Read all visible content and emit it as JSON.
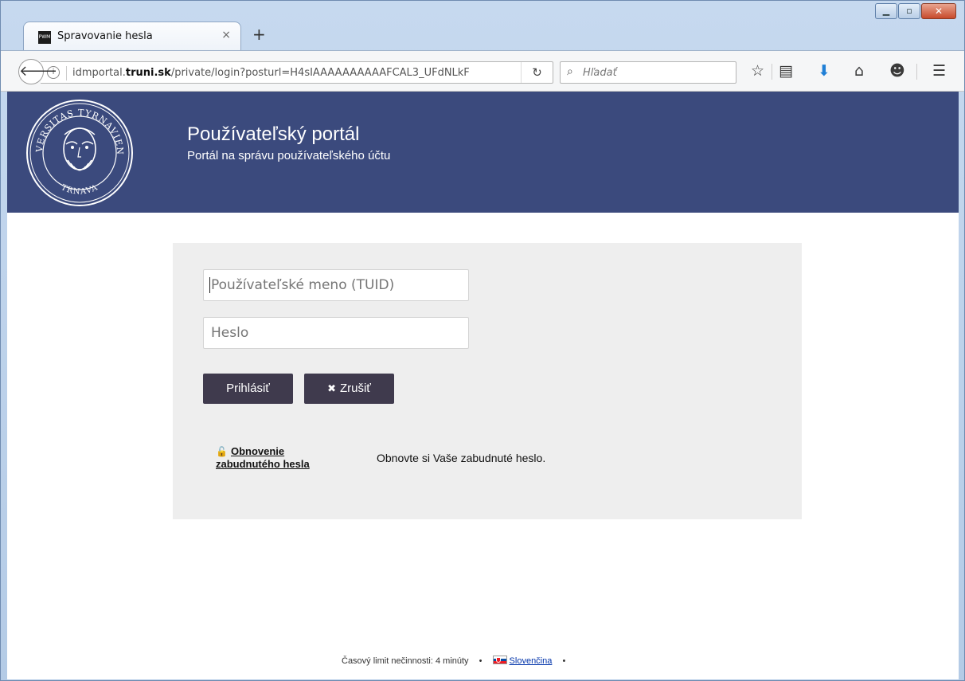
{
  "browser": {
    "tab_title": "Spravovanie hesla",
    "favicon_text": "PWM",
    "tab_close": "×",
    "new_tab": "+",
    "url_prefix": "idmportal.",
    "url_domain": "truni.sk",
    "url_path": "/private/login?posturl=H4sIAAAAAAAAAAFCAL3_UFdNLkF",
    "search_placeholder": "Hľadať"
  },
  "header": {
    "title": "Používateľský portál",
    "subtitle": "Portál na správu používateľského účtu",
    "logo_text_top": "UNIVERSITAS TYRNAVIENSIS",
    "logo_text_bottom": "TRNAVA"
  },
  "login": {
    "username_placeholder": "Používateľské meno (TUID)",
    "password_placeholder": "Heslo",
    "login_button": "Prihlásiť",
    "cancel_button": "Zrušiť",
    "recover_link": "Obnovenie zabudnutého hesla",
    "recover_description": "Obnovte si Vaše zabudnuté heslo."
  },
  "footer": {
    "timeout_text": "Časový limit nečinnosti: 4 minúty",
    "language": "Slovenčina"
  },
  "colors": {
    "header_bg": "#3b4a7d",
    "button_bg": "#3f3a4d",
    "panel_bg": "#eeeeee"
  }
}
